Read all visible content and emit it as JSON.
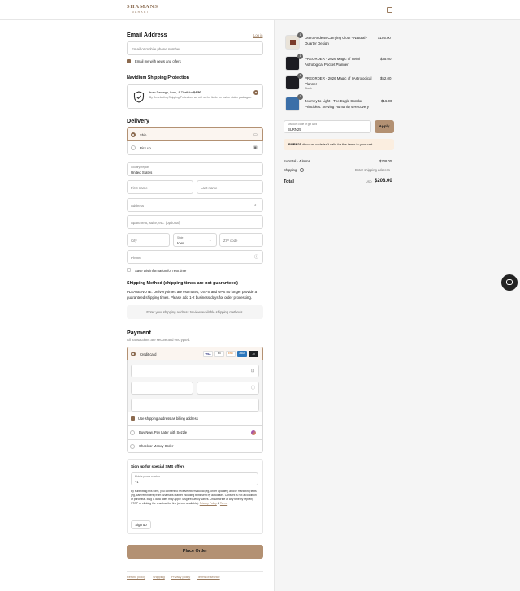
{
  "brand": {
    "line1": "SHAMANS",
    "line2": "MARKET"
  },
  "contact": {
    "title": "Email Address",
    "login_link": "Log in",
    "email_placeholder": "Email or mobile phone number",
    "news_label": "Email me with news and offers"
  },
  "protection": {
    "title": "Navidium Shipping Protection",
    "line1_prefix": "from Damage, Loss, & Theft for ",
    "price": "$4.50",
    "desc": "By Deselecting Shipping Protection, we will not be liable for lost or stolen packages."
  },
  "delivery": {
    "title": "Delivery",
    "options": [
      "Ship",
      "Pick up"
    ],
    "country_label": "Country/Region",
    "country_value": "United States",
    "first_name": "First name",
    "last_name": "Last name",
    "address": "Address",
    "apartment": "Apartment, suite, etc. (optional)",
    "city": "City",
    "state_label": "State",
    "state_value": "Iowa",
    "zip": "ZIP code",
    "phone": "Phone",
    "save_label": "Save this information for next time"
  },
  "shipping_method": {
    "title": "Shipping Method (shipping times are not guaranteed)",
    "notice": "PLEASE NOTE: Delivery times are estimates, USPS and UPS no longer provide a guaranteed shipping times. Please add 1-2 business days for order processing.",
    "empty": "Enter your shipping address to view available shipping methods."
  },
  "payment": {
    "title": "Payment",
    "subtitle": "All transactions are secure and encrypted.",
    "credit_card": "Credit card",
    "card_brands": [
      "VISA",
      "MC",
      "DISC",
      "AMEX",
      "+3"
    ],
    "billing_label": "Use shipping address as billing address",
    "sezzle": "Buy Now, Pay Later with Sezzle",
    "money_order": "Check or Money Order"
  },
  "sms": {
    "title": "Sign up for special SMS offers",
    "phone_label": "Mobile phone number",
    "phone_value": "+1",
    "legal": "By submitting this form, you consent to receive informational (eg, order updates) and/or marketing texts (eg, cart reminders) from Shamans Market including texts sent by autodialer. Consent is not a condition of purchase. Msg & data rates may apply. Msg frequency varies. Unsubscribe at any time by replying STOP or clicking the unsubscribe link (where available).",
    "privacy": "Privacy Policy",
    "amp": "&",
    "terms": "Terms",
    "signup": "Sign up"
  },
  "place_order": "Place Order",
  "footer_links": [
    "Refund policy",
    "Shipping",
    "Privacy policy",
    "Terms of service"
  ],
  "cart": {
    "items": [
      {
        "qty": "1",
        "name": "Otero Andean Carrying Cloth - Natural - Quarter Design",
        "variant": "",
        "price": "$105.00"
      },
      {
        "qty": "1",
        "name": "PREORDER - 2026 Magic of I Mini Astrological Pocket Planner",
        "variant": "",
        "price": "$35.00"
      },
      {
        "qty": "1",
        "name": "PREORDER - 2026 Magic of I Astrological Planner",
        "variant": "Black",
        "price": "$52.00"
      },
      {
        "qty": "1",
        "name": "Journey to Light - The Eagle Condor Principles: Serving Humanity's Recovery",
        "variant": "",
        "price": "$16.00"
      }
    ],
    "discount_label": "Discount code or gift card",
    "discount_value": "BURN25",
    "apply": "Apply",
    "error_code": "BURN25",
    "error_rest": " discount code isn't valid for the items in your cart",
    "subtotal_label": "Subtotal · 4 items",
    "subtotal_value": "$208.00",
    "shipping_label": "Shipping",
    "shipping_value": "Enter shipping address",
    "total_label": "Total",
    "currency": "USD",
    "total_value": "$208.00"
  }
}
